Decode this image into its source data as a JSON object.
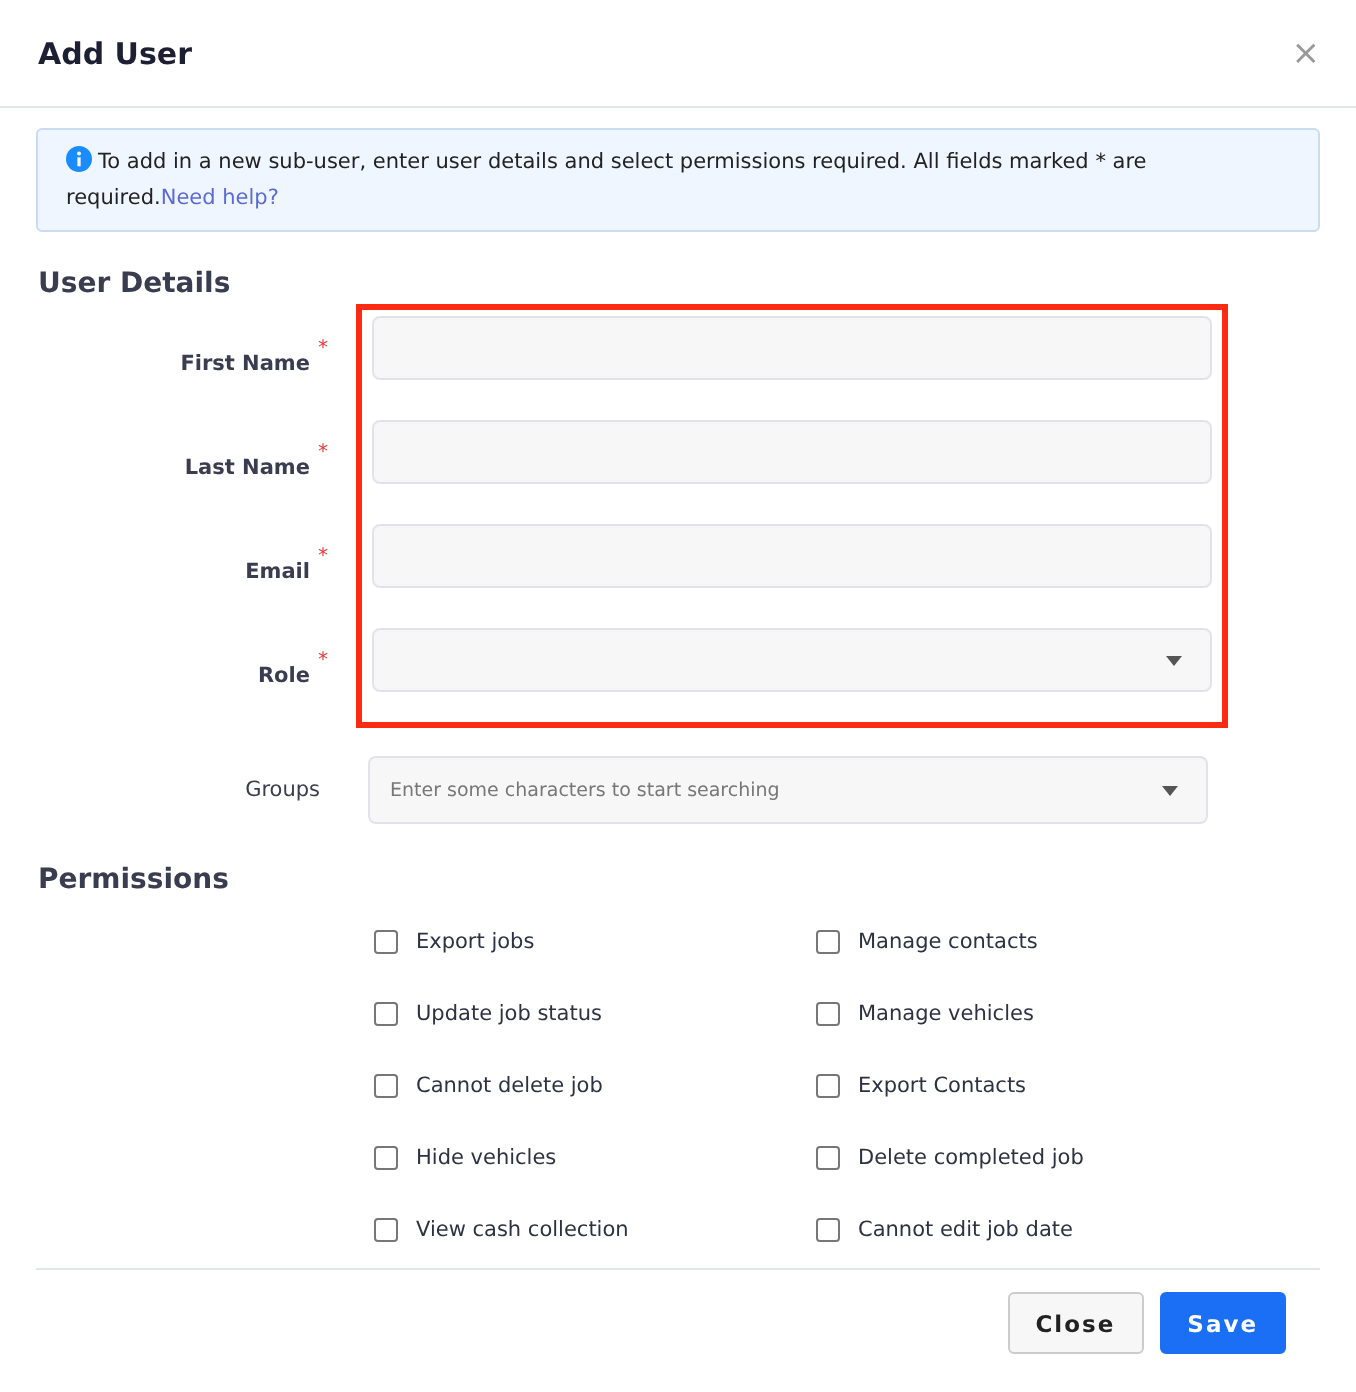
{
  "dialog": {
    "title": "Add User",
    "close_icon": "×"
  },
  "notice": {
    "text": "To add in a new sub-user, enter user details and select permissions required. All fields marked * are required.",
    "link": "Need help?"
  },
  "user_details": {
    "heading": "User Details",
    "highlighted": true,
    "fields": [
      {
        "label": "First Name",
        "kind": "text",
        "required_mark": "*"
      },
      {
        "label": "Last Name",
        "kind": "text",
        "required_mark": "*"
      },
      {
        "label": "Email",
        "kind": "text",
        "required_mark": "*"
      },
      {
        "label": "Role",
        "kind": "select",
        "required_mark": "*"
      }
    ]
  },
  "groups": {
    "label": "Groups",
    "kind": "select",
    "placeholder": "Enter some characters to start searching"
  },
  "permissions": {
    "heading": "Permissions",
    "items": [
      {
        "label": "Export jobs",
        "checked": false
      },
      {
        "label": "Manage contacts",
        "checked": false
      },
      {
        "label": "Update job status",
        "checked": false
      },
      {
        "label": "Manage vehicles",
        "checked": false
      },
      {
        "label": "Cannot delete job",
        "checked": false
      },
      {
        "label": "Export Contacts",
        "checked": false
      },
      {
        "label": "Hide vehicles",
        "checked": false
      },
      {
        "label": "Delete completed job",
        "checked": false
      },
      {
        "label": "View cash collection",
        "checked": false
      },
      {
        "label": "Cannot edit job date",
        "checked": false
      }
    ]
  },
  "buttons": [
    {
      "label": "Close",
      "kind": "secondary"
    },
    {
      "label": "Save",
      "kind": "primary"
    }
  ]
}
